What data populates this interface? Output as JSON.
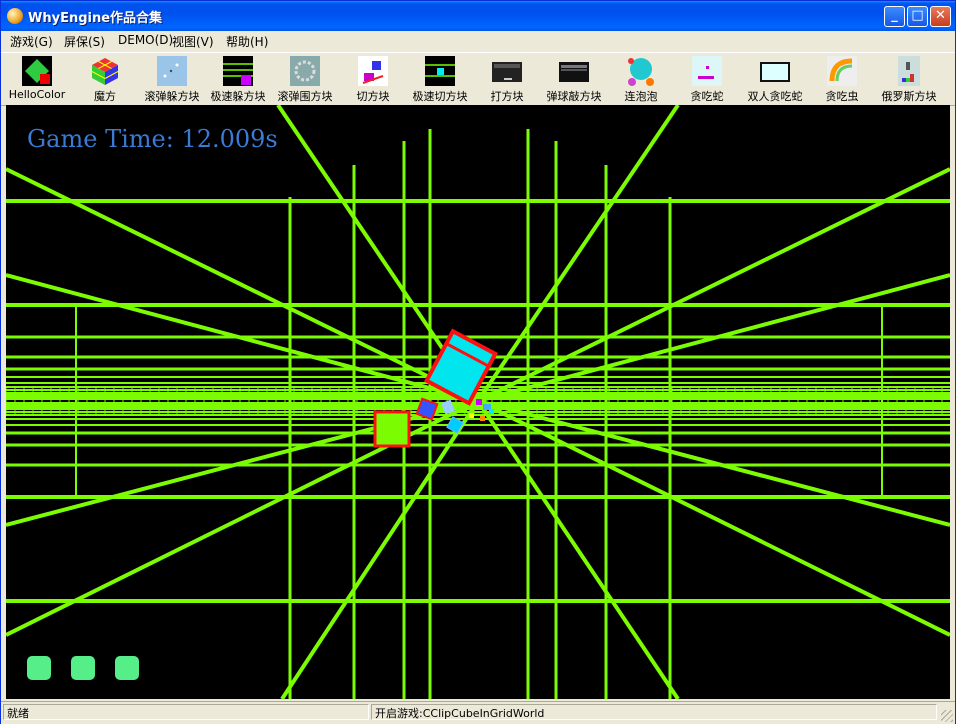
{
  "window": {
    "title": "WhyEngine作品合集"
  },
  "titlebar_buttons": {
    "minimize": "_",
    "maximize": "□",
    "close": "✕"
  },
  "menu": [
    {
      "label": "游戏(G)"
    },
    {
      "label": "屏保(S)"
    },
    {
      "label": "DEMO(D)"
    },
    {
      "label": "视图(V)"
    },
    {
      "label": "帮助(H)"
    }
  ],
  "toolbar": [
    {
      "label": "HelloColor",
      "icon": "hellocolor-icon"
    },
    {
      "label": "魔方",
      "icon": "rubiks-cube-icon"
    },
    {
      "label": "滚弹躲方块",
      "icon": "rolling-ball-dodge-icon"
    },
    {
      "label": "极速躲方块",
      "icon": "speed-dodge-icon"
    },
    {
      "label": "滚弹围方块",
      "icon": "rolling-ball-surround-icon"
    },
    {
      "label": "切方块",
      "icon": "cut-cube-icon"
    },
    {
      "label": "极速切方块",
      "icon": "speed-cut-icon"
    },
    {
      "label": "打方块",
      "icon": "hit-block-icon"
    },
    {
      "label": "弹球敲方块",
      "icon": "pinball-block-icon"
    },
    {
      "label": "连泡泡",
      "icon": "bubble-icon"
    },
    {
      "label": "贪吃蛇",
      "icon": "snake-icon"
    },
    {
      "label": "双人贪吃蛇",
      "icon": "two-player-snake-icon"
    },
    {
      "label": "贪吃虫",
      "icon": "worm-icon"
    },
    {
      "label": "俄罗斯方块",
      "icon": "tetris-icon"
    }
  ],
  "game": {
    "time_text": "Game Time: 12.009s",
    "lives": 3,
    "grid_color": "#7cfc00",
    "cube_color": "#00e5ee",
    "edge_color": "#ff1010"
  },
  "status": {
    "left": "就绪",
    "right": "开启游戏:CClipCubeInGridWorld"
  }
}
